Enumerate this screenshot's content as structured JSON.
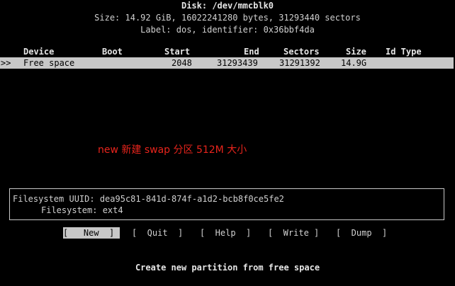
{
  "header": {
    "disk": "Disk: /dev/mmcblk0",
    "size": "Size: 14.92 GiB, 16022241280 bytes, 31293440 sectors",
    "label": "Label: dos, identifier: 0x36bbf4da"
  },
  "table": {
    "columns": [
      "Device",
      "Boot",
      "Start",
      "End",
      "Sectors",
      "Size",
      "Id Type"
    ],
    "rows": [
      {
        "cursor": ">>",
        "device": "Free space",
        "boot": "",
        "start": "2048",
        "end": "31293439",
        "sectors": "31291392",
        "size": "14.9G",
        "id_type": ""
      }
    ]
  },
  "annotation": "new 新建 swap 分区 512M 大小",
  "info": {
    "uuid": "Filesystem UUID: dea95c81-841d-874f-a1d2-bcb8f0ce5fe2",
    "filesystem": "Filesystem: ext4"
  },
  "menu": {
    "new": "[   New  ]",
    "quit": "[  Quit  ]",
    "help": "[  Help  ]",
    "write": "[  Write ]",
    "dump": "[  Dump  ]"
  },
  "status": "Create new partition from free space",
  "colors": {
    "background": "#000000",
    "foreground": "#d0d0d0",
    "highlight": "#c8c8c8",
    "annotation": "#e8241c"
  }
}
